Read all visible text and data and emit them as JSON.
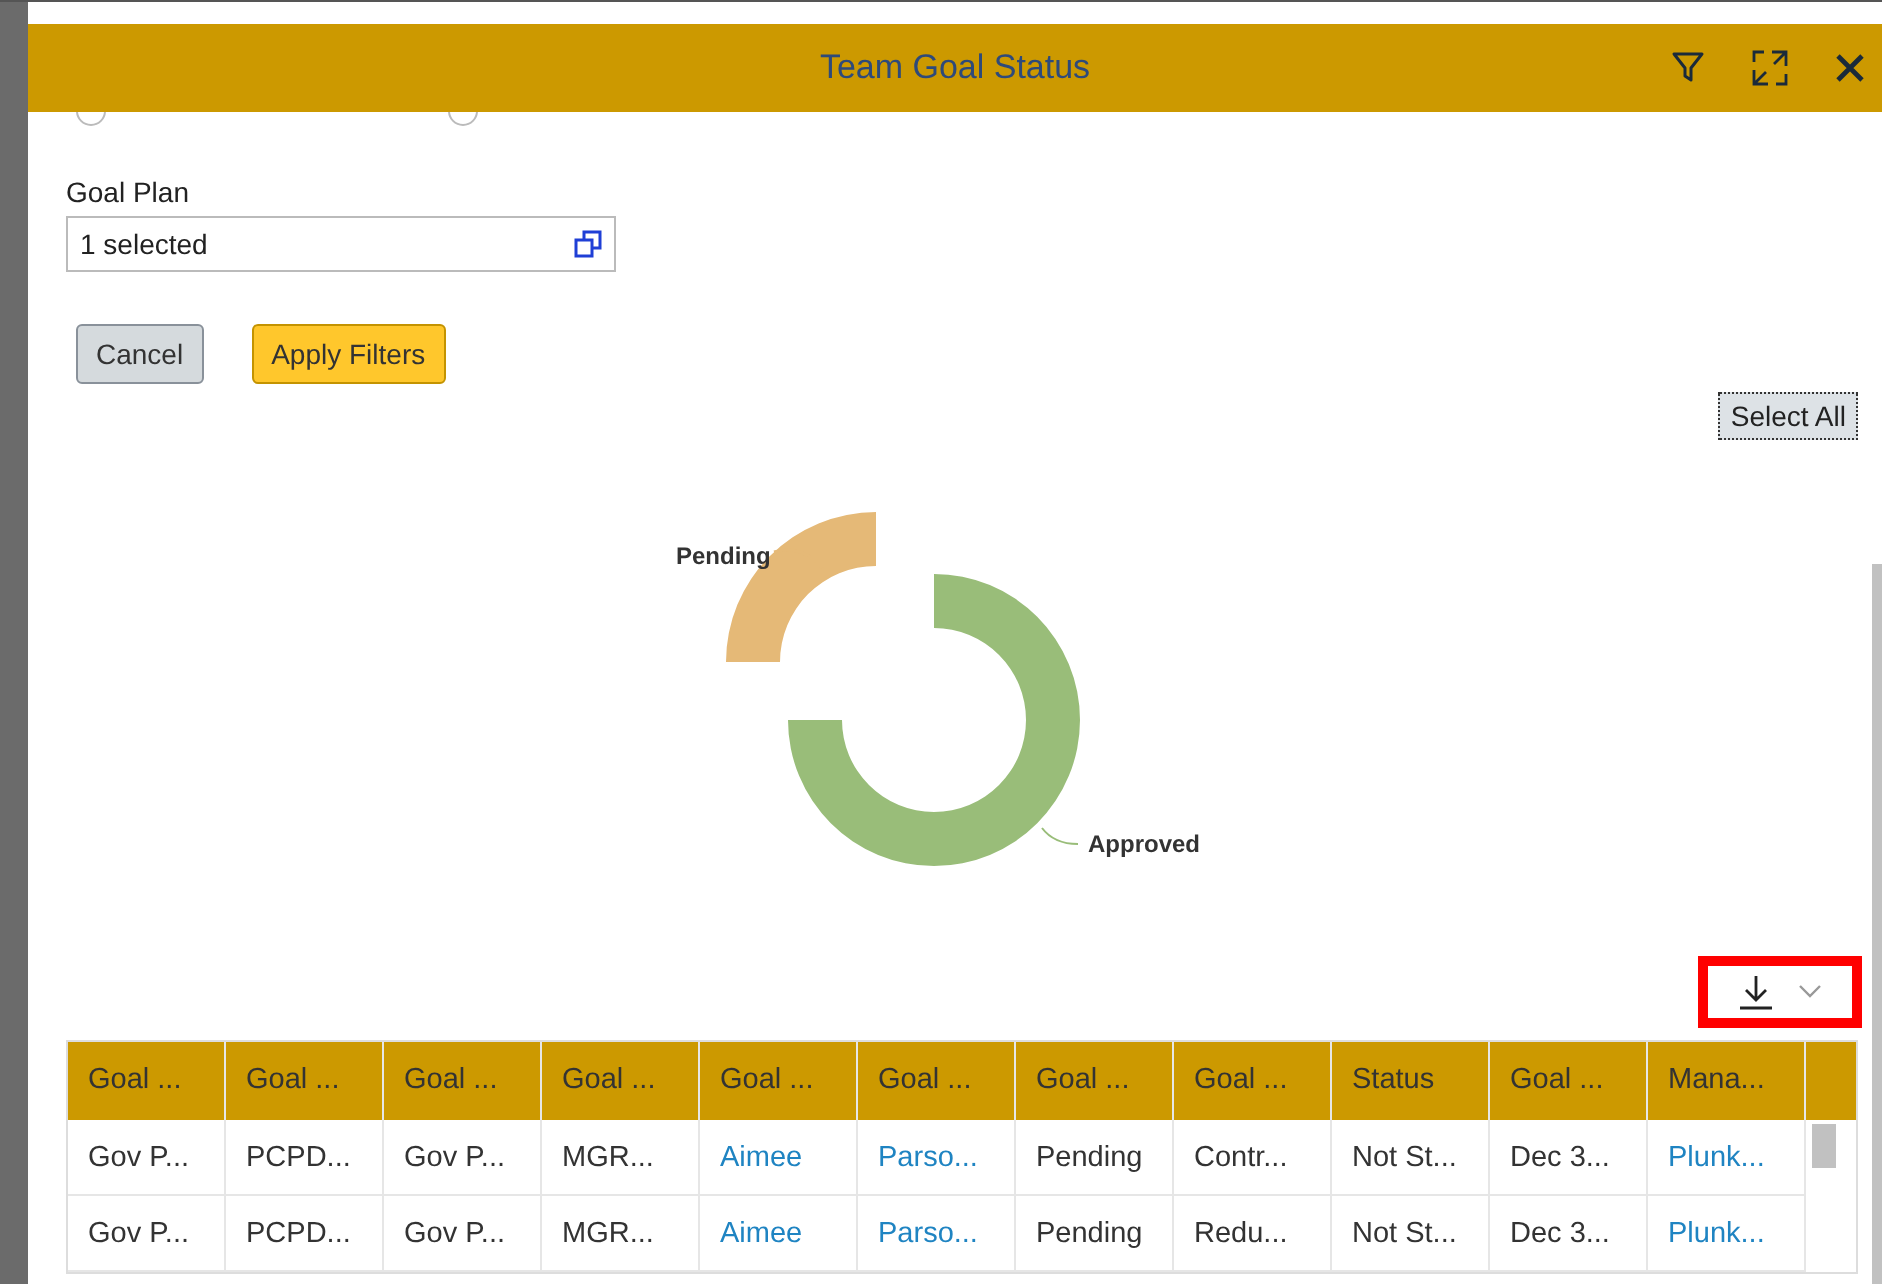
{
  "dialog": {
    "title": "Team Goal Status"
  },
  "radios": [
    {
      "selected": false
    },
    {
      "selected": false
    }
  ],
  "filter": {
    "label": "Goal Plan",
    "value": "1 selected"
  },
  "buttons": [
    {
      "label": "Cancel",
      "kind": "secondary"
    },
    {
      "label": "Apply Filters",
      "kind": "primary"
    }
  ],
  "select_all": "Select All",
  "donut": {
    "slices": [
      {
        "label": "Pending",
        "color": "#e5b977"
      },
      {
        "label": "Approved",
        "color": "#99bd79"
      }
    ]
  },
  "download": {
    "highlighted": true
  },
  "table": {
    "columns": [
      "Goal ...",
      "Goal ...",
      "Goal ...",
      "Goal ...",
      "Goal ...",
      "Goal ...",
      "Goal ...",
      "Goal ...",
      "Status",
      "Goal ...",
      "Mana..."
    ],
    "rows": [
      [
        {
          "text": "Gov P...",
          "link": false
        },
        {
          "text": "PCPD...",
          "link": false
        },
        {
          "text": "Gov P...",
          "link": false
        },
        {
          "text": "MGR...",
          "link": false
        },
        {
          "text": "Aimee",
          "link": true
        },
        {
          "text": "Parso...",
          "link": true
        },
        {
          "text": "Pending",
          "link": false
        },
        {
          "text": "Contr...",
          "link": false
        },
        {
          "text": "Not St...",
          "link": false
        },
        {
          "text": "Dec 3...",
          "link": false
        },
        {
          "text": "Plunk...",
          "link": true
        }
      ],
      [
        {
          "text": "Gov P...",
          "link": false
        },
        {
          "text": "PCPD...",
          "link": false
        },
        {
          "text": "Gov P...",
          "link": false
        },
        {
          "text": "MGR...",
          "link": false
        },
        {
          "text": "Aimee",
          "link": true
        },
        {
          "text": "Parso...",
          "link": true
        },
        {
          "text": "Pending",
          "link": false
        },
        {
          "text": "Redu...",
          "link": false
        },
        {
          "text": "Not St...",
          "link": false
        },
        {
          "text": "Dec 3...",
          "link": false
        },
        {
          "text": "Plunk...",
          "link": true
        }
      ]
    ]
  }
}
